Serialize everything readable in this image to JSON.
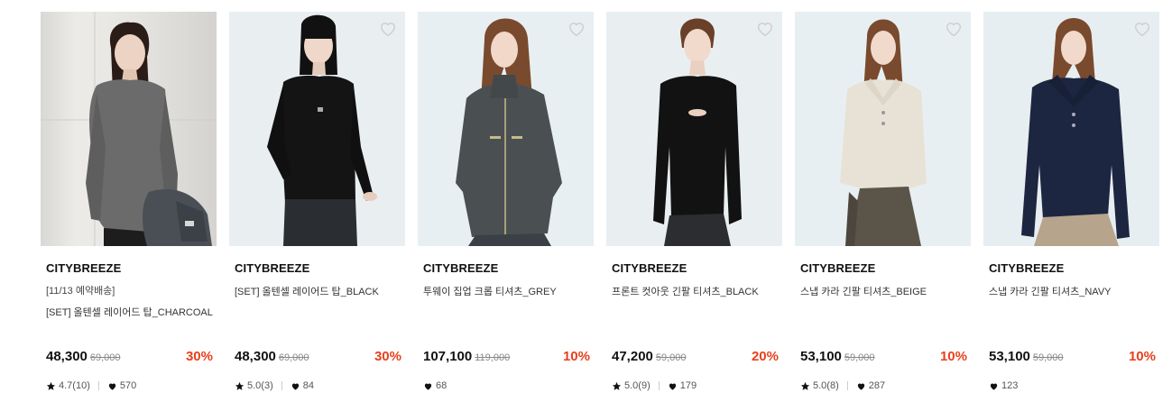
{
  "products": [
    {
      "brand": "CITYBREEZE",
      "tag": "[11/13 예약배송]",
      "title": "[SET] 올텐셀 레이어드 탑_CHARCOAL",
      "price": "48,300",
      "original_price": "69,000",
      "discount": "30%",
      "rating": "4.7(10)",
      "likes": "570",
      "garment_color": "#6b6b6b",
      "background_color": "#e9e7e2"
    },
    {
      "brand": "CITYBREEZE",
      "title": "[SET] 올텐셀 레이어드 탑_BLACK",
      "price": "48,300",
      "original_price": "69,000",
      "discount": "30%",
      "rating": "5.0(3)",
      "likes": "84",
      "garment_color": "#141414",
      "background_color": "#e8eef2"
    },
    {
      "brand": "CITYBREEZE",
      "title": "투웨이 집업 크롭 티셔츠_GREY",
      "price": "107,100",
      "original_price": "119,000",
      "discount": "10%",
      "likes": "68",
      "garment_color": "#4a5052",
      "background_color": "#e6edf0"
    },
    {
      "brand": "CITYBREEZE",
      "title": "프론트 컷아웃 긴팔 티셔츠_BLACK",
      "price": "47,200",
      "original_price": "59,000",
      "discount": "20%",
      "rating": "5.0(9)",
      "likes": "179",
      "garment_color": "#121212",
      "background_color": "#e8eef2"
    },
    {
      "brand": "CITYBREEZE",
      "title": "스냅 카라 긴팔 티셔츠_BEIGE",
      "price": "53,100",
      "original_price": "59,000",
      "discount": "10%",
      "rating": "5.0(8)",
      "likes": "287",
      "garment_color": "#e8e2d6",
      "background_color": "#e6edf0"
    },
    {
      "brand": "CITYBREEZE",
      "title": "스냅 카라 긴팔 티셔츠_NAVY",
      "price": "53,100",
      "original_price": "59,000",
      "discount": "10%",
      "likes": "123",
      "garment_color": "#1c2640",
      "background_color": "#e6edf0"
    }
  ],
  "colors": {
    "discount": "#e8401c",
    "original_price": "#888888",
    "brand": "#111111"
  },
  "icons": {
    "wishlist": "heart-outline-icon",
    "rating": "star-icon",
    "likes": "heart-filled-icon"
  }
}
